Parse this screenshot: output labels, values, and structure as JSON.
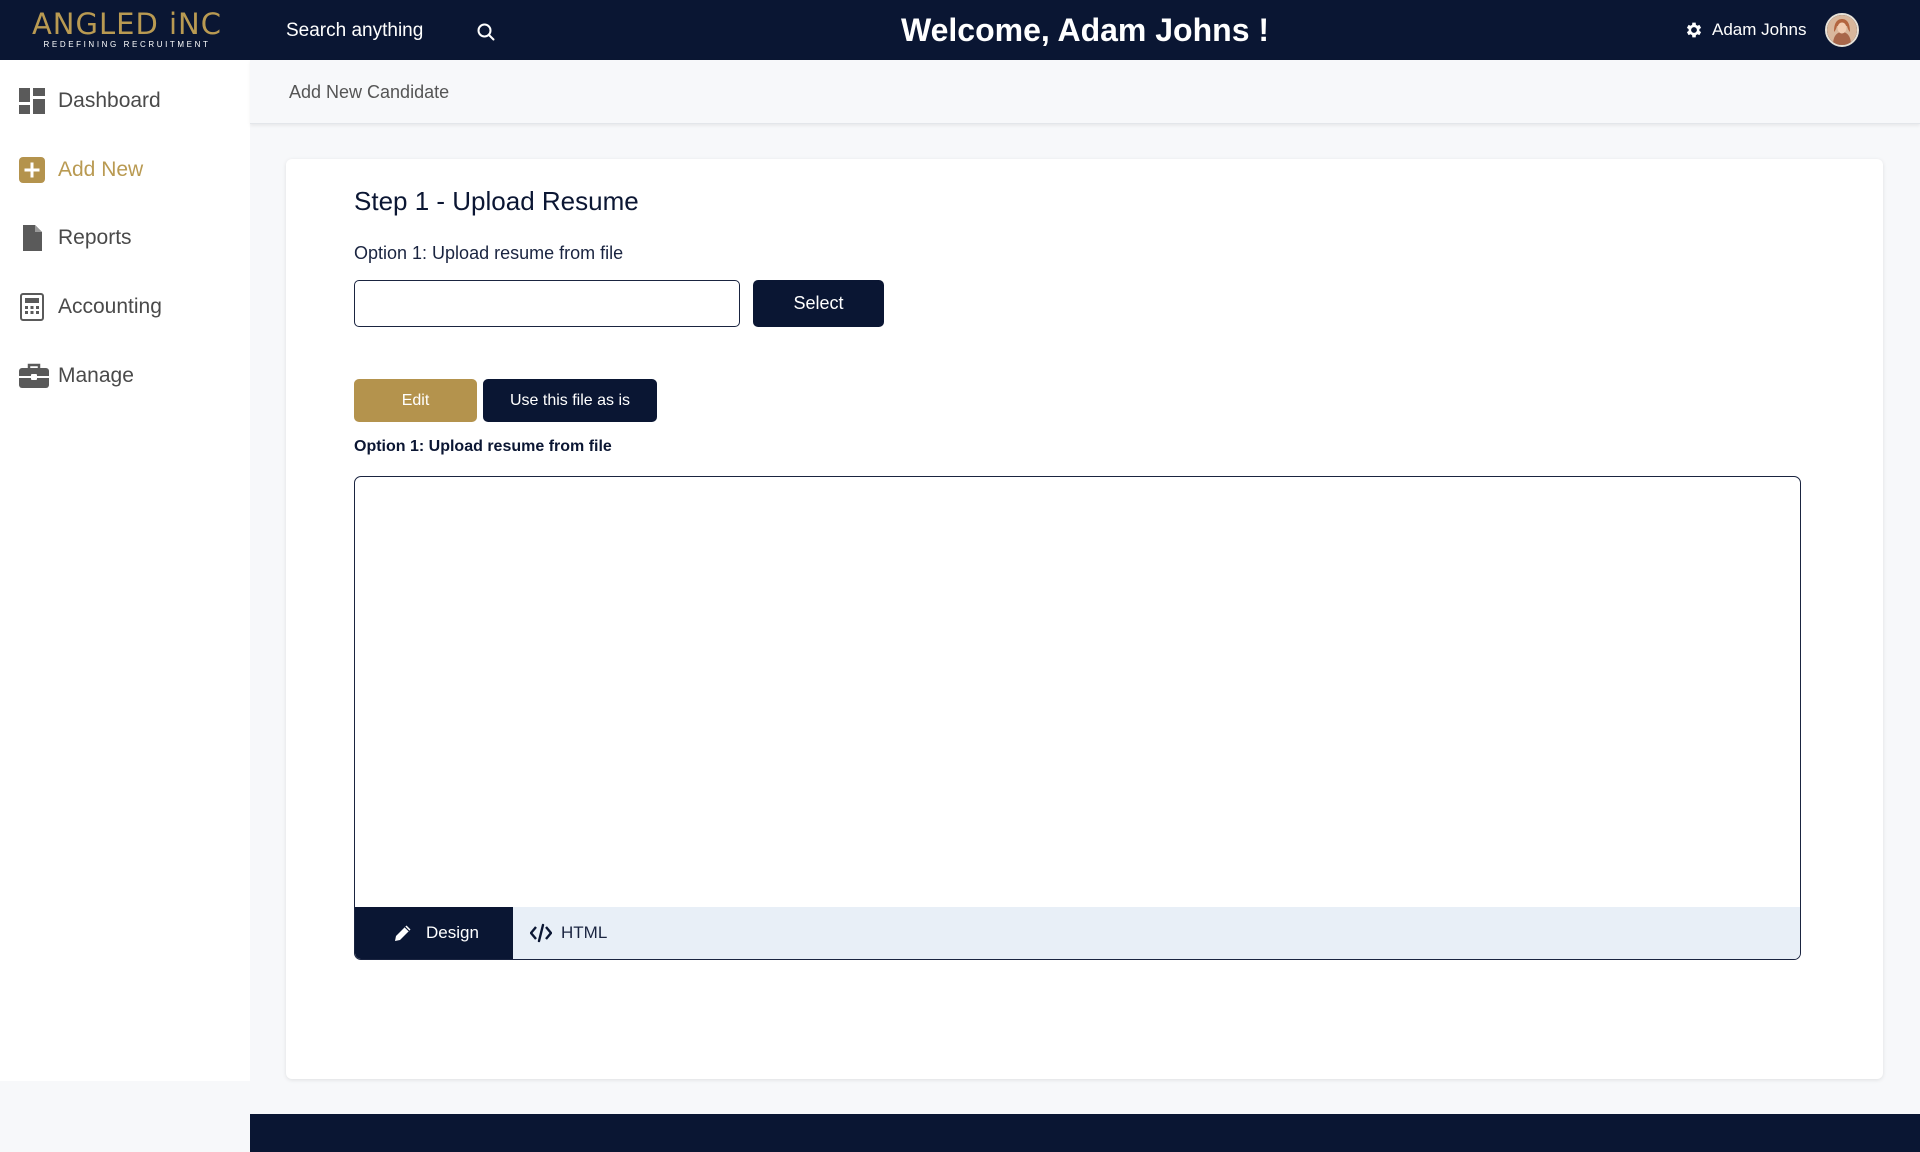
{
  "header": {
    "logo_text": "ANGLED iNC",
    "logo_tagline": "REDEFINING RECRUITMENT",
    "search_placeholder": "Search anything",
    "welcome": "Welcome, Adam Johns !",
    "user_name": "Adam Johns"
  },
  "sidebar": {
    "items": [
      {
        "label": "Dashboard",
        "icon": "dashboard-icon",
        "active": false
      },
      {
        "label": "Add New",
        "icon": "plus-square-icon",
        "active": true
      },
      {
        "label": "Reports",
        "icon": "document-icon",
        "active": false
      },
      {
        "label": "Accounting",
        "icon": "calculator-icon",
        "active": false
      },
      {
        "label": "Manage",
        "icon": "briefcase-icon",
        "active": false
      }
    ]
  },
  "page": {
    "title": "Add New Candidate"
  },
  "form": {
    "step_title": "Step 1 - Upload Resume",
    "option_label": "Option 1: Upload resume from file",
    "file_value": "",
    "select_label": "Select",
    "edit_label": "Edit",
    "use_file_label": "Use this file as is",
    "editor_label": "Option 1: Upload resume from file",
    "editor_tabs": [
      {
        "label": "Design",
        "icon": "pencil-icon",
        "active": true
      },
      {
        "label": "HTML",
        "icon": "code-icon",
        "active": false
      }
    ]
  },
  "colors": {
    "navy": "#0a1633",
    "gold": "#b4934d",
    "accent_gold": "#b99a52",
    "tab_bar": "#e8eff7"
  }
}
